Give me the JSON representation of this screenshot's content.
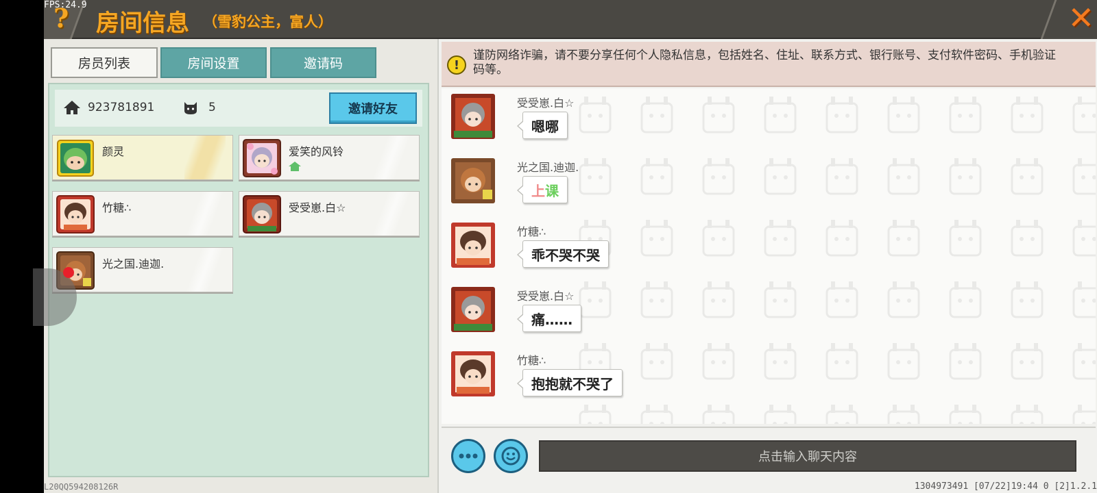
{
  "fps": "FPS:24.9",
  "header": {
    "help_icon": "question-mark",
    "title": "房间信息",
    "subtitle": "（雪豹公主，富人）",
    "close_icon": "close-x"
  },
  "tabs": [
    {
      "label": "房员列表",
      "active": true
    },
    {
      "label": "房间设置",
      "active": false
    },
    {
      "label": "邀请码",
      "active": false
    }
  ],
  "room": {
    "id": "923781891",
    "member_count": "5",
    "invite_button": "邀请好友"
  },
  "members": [
    {
      "name": "颜灵",
      "is_host": true
    },
    {
      "name": "爱笑的风铃",
      "has_house_badge": true
    },
    {
      "name": "竹糖∴"
    },
    {
      "name": "受受崽.白☆"
    },
    {
      "name": "光之国.迪迦."
    }
  ],
  "left_footer": "L20QQ594208126R",
  "warning": {
    "icon": "exclamation",
    "text": "谨防网络诈骗，请不要分享任何个人隐私信息，包括姓名、住址、联系方式、银行账号、支付软件密码、手机验证码等。"
  },
  "messages": [
    {
      "sender": "受受崽.白☆",
      "text": "嗯哪"
    },
    {
      "sender": "光之国.迪迦.",
      "text_part1": "上",
      "text_part2": "课"
    },
    {
      "sender": "竹糖∴",
      "text": "乖不哭不哭"
    },
    {
      "sender": "受受崽.白☆",
      "text": "痛……"
    },
    {
      "sender": "竹糖∴",
      "text": "抱抱就不哭了"
    }
  ],
  "input": {
    "placeholder": "点击输入聊天内容",
    "more_icon": "ellipsis",
    "emoji_icon": "smiley"
  },
  "right_footer": "1304973491   [07/22]19:44 0   [2]1.2.1",
  "colors": {
    "accent_orange": "#f5a623",
    "tab_teal": "#5ea5a4",
    "invite_blue": "#5ac8ea",
    "panel_green": "#cfe6d8",
    "warning_bg": "#e9d6cf"
  }
}
